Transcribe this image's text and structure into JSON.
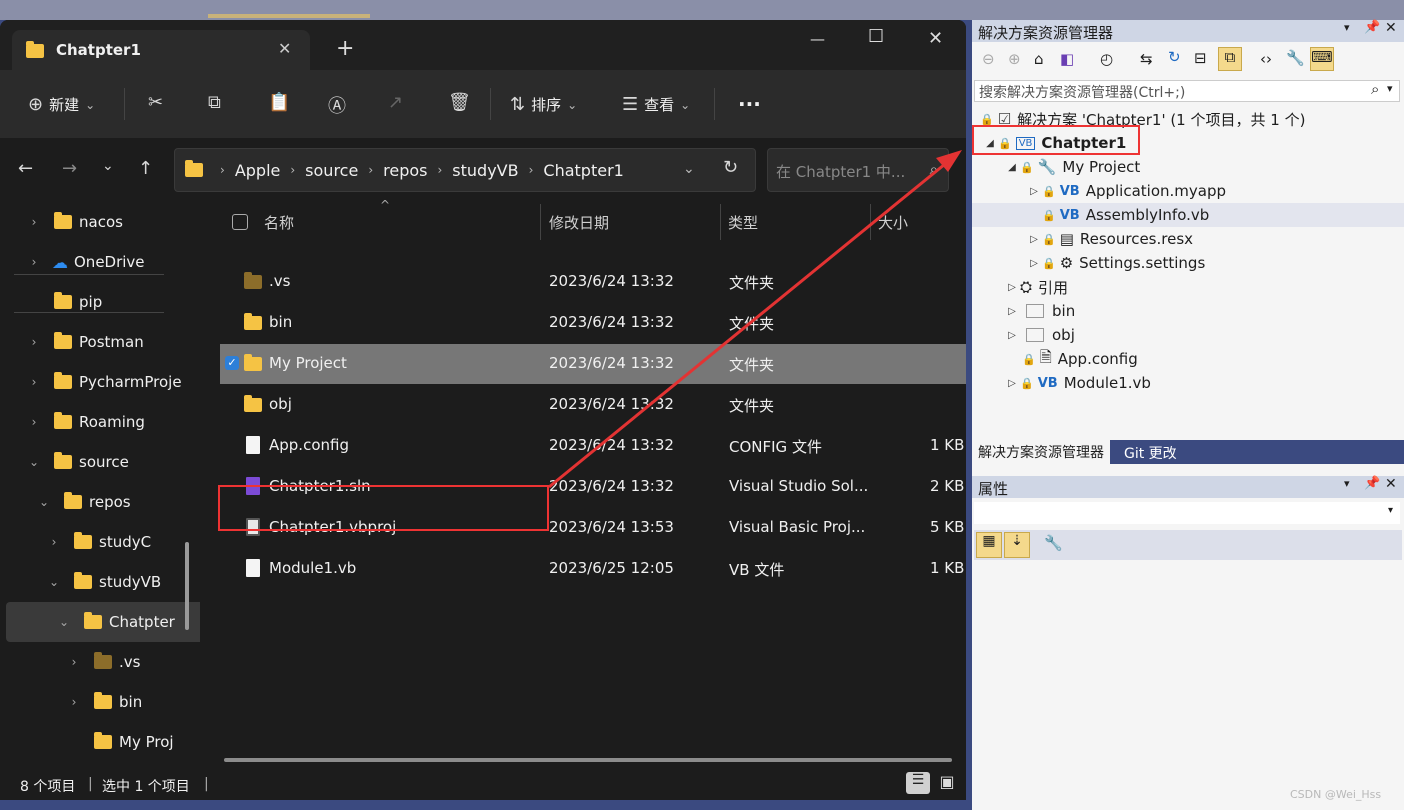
{
  "explorer": {
    "tab_title": "Chatpter1",
    "new_tab_symbol": "+",
    "window_controls": {
      "minimize": "—",
      "maximize": "☐",
      "close": "✕"
    },
    "toolbar": {
      "new_label": "新建",
      "sort_label": "排序",
      "view_label": "查看",
      "more_label": "···"
    },
    "breadcrumb": [
      "Apple",
      "source",
      "repos",
      "studyVB",
      "Chatpter1"
    ],
    "search_placeholder": "在 Chatpter1 中...",
    "nav_items": [
      {
        "label": "nacos"
      },
      {
        "label": "OneDrive"
      },
      {
        "label": "pip"
      },
      {
        "label": "Postman"
      },
      {
        "label": "PycharmProje"
      },
      {
        "label": "Roaming"
      },
      {
        "label": "source"
      },
      {
        "label": "repos"
      },
      {
        "label": "studyC"
      },
      {
        "label": "studyVB"
      },
      {
        "label": "Chatpter"
      },
      {
        "label": ".vs"
      },
      {
        "label": "bin"
      },
      {
        "label": "My Proj"
      }
    ],
    "columns": {
      "name": "名称",
      "date": "修改日期",
      "type": "类型",
      "size": "大小"
    },
    "files": [
      {
        "name": ".vs",
        "date": "2023/6/24 13:32",
        "type": "文件夹",
        "size": ""
      },
      {
        "name": "bin",
        "date": "2023/6/24 13:32",
        "type": "文件夹",
        "size": ""
      },
      {
        "name": "My Project",
        "date": "2023/6/24 13:32",
        "type": "文件夹",
        "size": ""
      },
      {
        "name": "obj",
        "date": "2023/6/24 13:32",
        "type": "文件夹",
        "size": ""
      },
      {
        "name": "App.config",
        "date": "2023/6/24 13:32",
        "type": "CONFIG 文件",
        "size": "1 KB"
      },
      {
        "name": "Chatpter1.sln",
        "date": "2023/6/24 13:32",
        "type": "Visual Studio Sol...",
        "size": "2 KB"
      },
      {
        "name": "Chatpter1.vbproj",
        "date": "2023/6/24 13:53",
        "type": "Visual Basic Proj...",
        "size": "5 KB"
      },
      {
        "name": "Module1.vb",
        "date": "2023/6/25 12:05",
        "type": "VB 文件",
        "size": "1 KB"
      }
    ],
    "status": {
      "count": "8 个项目",
      "selected": "选中 1 个项目"
    }
  },
  "vs": {
    "panel_title": "解决方案资源管理器",
    "search_placeholder": "搜索解决方案资源管理器(Ctrl+;)",
    "solution_label": "解决方案 'Chatpter1' (1 个项目，共 1 个)",
    "tree": {
      "project": "Chatpter1",
      "my_project": "My Project",
      "application": "Application.myapp",
      "assemblyinfo": "AssemblyInfo.vb",
      "resources": "Resources.resx",
      "settings": "Settings.settings",
      "references": "引用",
      "bin": "bin",
      "obj": "obj",
      "appconfig": "App.config",
      "module": "Module1.vb"
    },
    "vb_badge": "VB",
    "bottom_tabs": [
      "解决方案资源管理器",
      "Git 更改"
    ],
    "properties_title": "属性"
  },
  "watermark": "CSDN @Wei_Hss",
  "colors": {
    "selection": "#777777",
    "annotation_red": "#e33333",
    "vs_tab_blue": "#3b4a80"
  }
}
